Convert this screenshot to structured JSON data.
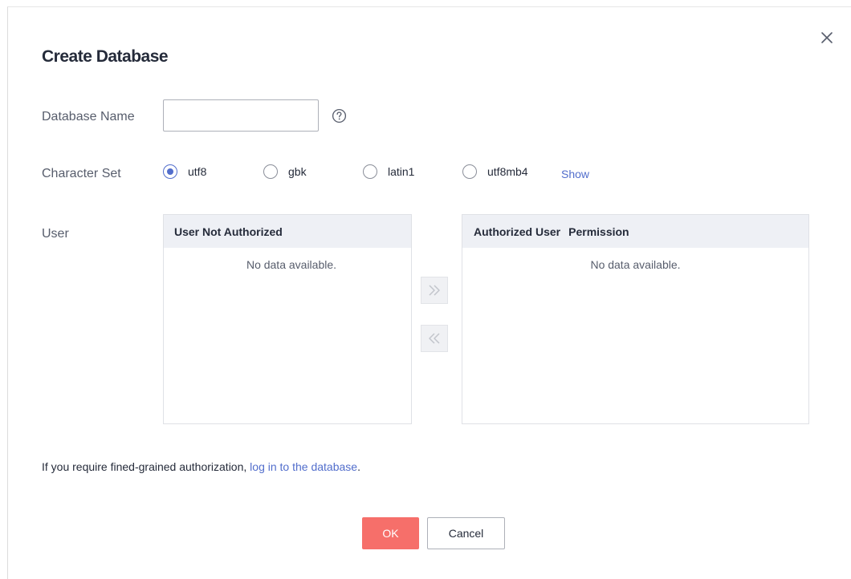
{
  "dialog": {
    "title": "Create Database",
    "close_icon": "close-icon"
  },
  "form": {
    "database_name": {
      "label": "Database Name",
      "value": "",
      "placeholder": "",
      "help_icon": "question-circle-icon"
    },
    "character_set": {
      "label": "Character Set",
      "options": [
        {
          "label": "utf8",
          "checked": true
        },
        {
          "label": "gbk",
          "checked": false
        },
        {
          "label": "latin1",
          "checked": false
        },
        {
          "label": "utf8mb4",
          "checked": false
        }
      ],
      "show_link": "Show"
    },
    "user": {
      "label": "User",
      "unauthorized": {
        "header": "User Not Authorized",
        "empty_text": "No data available."
      },
      "authorized": {
        "header_user": "Authorized User",
        "header_permission": "Permission",
        "empty_text": "No data available."
      },
      "move_right_icon": "double-chevron-right-icon",
      "move_left_icon": "double-chevron-left-icon"
    }
  },
  "hint": {
    "text": "If you require fined-grained authorization, ",
    "link": "log in to the database",
    "suffix": "."
  },
  "footer": {
    "ok_label": "OK",
    "cancel_label": "Cancel"
  },
  "colors": {
    "primary": "#526ecc",
    "ok_button": "#f66f6a",
    "panel_header": "#eef0f5"
  }
}
